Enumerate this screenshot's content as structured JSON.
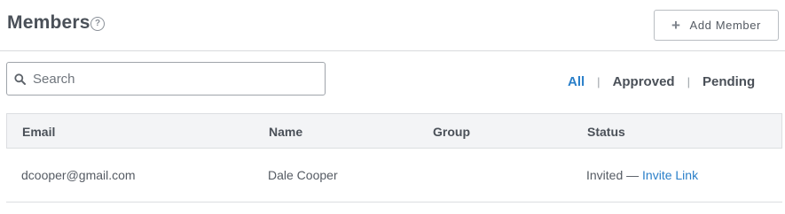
{
  "header": {
    "title": "Members",
    "help_glyph": "?",
    "add_button": {
      "icon": "plus-icon",
      "label": "Add Member"
    }
  },
  "search": {
    "placeholder": "Search",
    "value": ""
  },
  "filters": [
    {
      "label": "All",
      "active": true
    },
    {
      "label": "Approved",
      "active": false
    },
    {
      "label": "Pending",
      "active": false
    }
  ],
  "table": {
    "columns": [
      "Email",
      "Name",
      "Group",
      "Status"
    ],
    "rows": [
      {
        "email": "dcooper@gmail.com",
        "name": "Dale Cooper",
        "group": "",
        "status": "Invited —",
        "status_link": "Invite Link"
      }
    ]
  },
  "colors": {
    "accent": "#2a7fc9",
    "text": "#4a5058",
    "border": "#dcdee1",
    "header_bg": "#f3f4f6"
  }
}
